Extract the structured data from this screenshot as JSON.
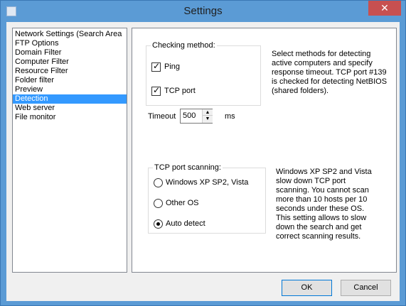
{
  "window": {
    "title": "Settings",
    "close_label": "✕"
  },
  "nav": {
    "items": [
      {
        "label": "Network Settings (Search Area"
      },
      {
        "label": "FTP Options"
      },
      {
        "label": "Domain Filter"
      },
      {
        "label": "Computer Filter"
      },
      {
        "label": "Resource Filter"
      },
      {
        "label": "Folder filter"
      },
      {
        "label": "Preview"
      },
      {
        "label": "Detection",
        "selected": true
      },
      {
        "label": "Web server"
      },
      {
        "label": "File monitor"
      }
    ]
  },
  "checking": {
    "caption": "Checking method:",
    "ping_label": "Ping",
    "ping_checked": true,
    "tcp_label": "TCP port",
    "tcp_checked": true,
    "description": "Select methods for detecting active computers and specify response timeout. TCP port #139 is checked for detecting NetBIOS (shared folders)."
  },
  "timeout": {
    "label": "Timeout",
    "value": "500",
    "unit": "ms"
  },
  "scanning": {
    "caption": "TCP port scanning:",
    "options": [
      {
        "label": "Windows XP SP2, Vista",
        "selected": false
      },
      {
        "label": "Other OS",
        "selected": false
      },
      {
        "label": "Auto detect",
        "selected": true
      }
    ],
    "description": "Windows XP SP2 and Vista slow down TCP port scanning. You cannot scan more than 10 hosts per 10 seconds under these OS. This setting allows to slow down the search and get correct scanning results."
  },
  "buttons": {
    "ok": "OK",
    "cancel": "Cancel"
  },
  "colors": {
    "selection": "#3399ff",
    "titlebar": "#5b9bd5",
    "close": "#c75050"
  }
}
